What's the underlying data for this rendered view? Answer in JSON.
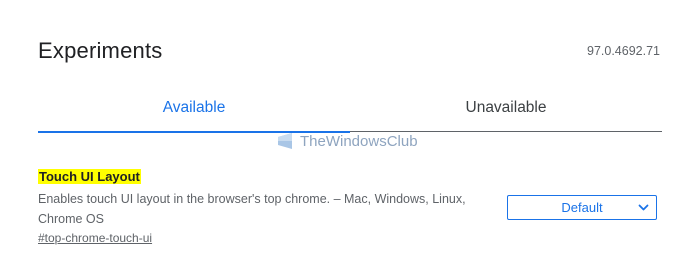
{
  "header": {
    "title": "Experiments",
    "version": "97.0.4692.71"
  },
  "tabs": [
    {
      "label": "Available",
      "active": true
    },
    {
      "label": "Unavailable",
      "active": false
    }
  ],
  "watermark": {
    "text": "TheWindowsClub",
    "icon": "windows-logo-icon"
  },
  "experiment": {
    "title": "Touch UI Layout",
    "description": "Enables touch UI layout in the browser's top chrome. – Mac, Windows, Linux, Chrome OS",
    "link": "#top-chrome-touch-ui",
    "select_value": "Default",
    "select_icon": "chevron-down-icon"
  },
  "colors": {
    "accent": "#1a73e8",
    "highlight": "#ffff00",
    "text": "#202124",
    "secondary_text": "#5f6368"
  }
}
